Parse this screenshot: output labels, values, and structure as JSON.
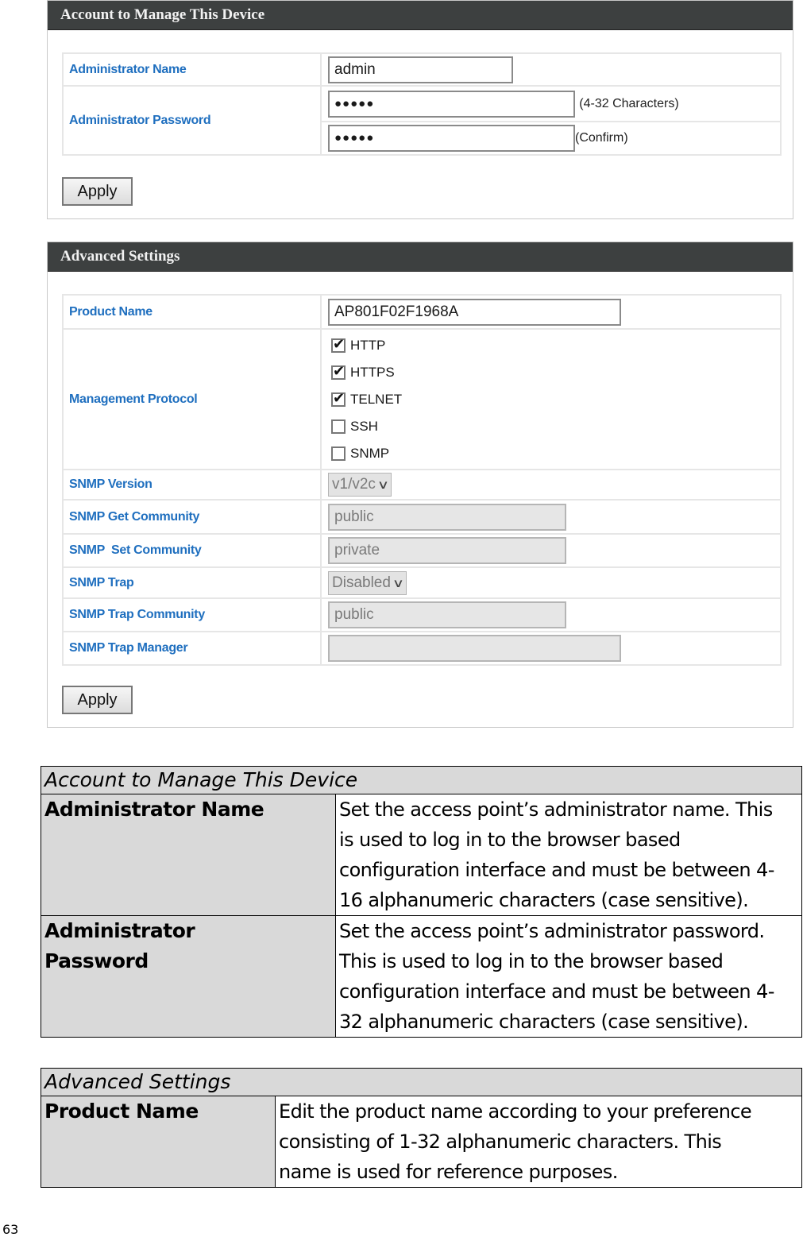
{
  "account_panel": {
    "title": "Account to Manage This Device",
    "admin_name_label": "Administrator Name",
    "admin_name_value": "admin",
    "admin_password_label": "Administrator Password",
    "password_value": "●●●●●",
    "confirm_value": "●●●●●",
    "password_hint": "(4-32 Characters)",
    "confirm_hint": "(Confirm)",
    "apply_label": "Apply"
  },
  "advanced_panel": {
    "title": "Advanced Settings",
    "product_name_label": "Product Name",
    "product_name_value": "AP801F02F1968A",
    "management_protocol_label": "Management Protocol",
    "protocols": [
      {
        "label": "HTTP",
        "checked": true
      },
      {
        "label": "HTTPS",
        "checked": true
      },
      {
        "label": "TELNET",
        "checked": true
      },
      {
        "label": "SSH",
        "checked": false
      },
      {
        "label": "SNMP",
        "checked": false
      }
    ],
    "snmp_version_label": "SNMP Version",
    "snmp_version_value": "v1/v2c",
    "snmp_get_label": "SNMP Get Community",
    "snmp_get_value": "public",
    "snmp_set_label": "SNMP  Set Community",
    "snmp_set_value": "private",
    "snmp_trap_label": "SNMP Trap",
    "snmp_trap_value": "Disabled",
    "snmp_trap_community_label": "SNMP Trap Community",
    "snmp_trap_community_value": "public",
    "snmp_trap_manager_label": "SNMP Trap Manager",
    "snmp_trap_manager_value": "",
    "apply_label": "Apply"
  },
  "doc_account": {
    "heading": "Account to Manage This Device",
    "rows": [
      {
        "term": "Administrator Name",
        "desc": "Set the access point’s administrator name. This is used to log in to the browser based configuration interface and must be between 4-16 alphanumeric characters (case sensitive)."
      },
      {
        "term": "Administrator Password",
        "desc": "Set the access point’s administrator password. This is used to log in to the browser based configuration interface and must be between 4-32 alphanumeric characters (case sensitive)."
      }
    ]
  },
  "doc_advanced": {
    "heading": "Advanced Settings",
    "rows": [
      {
        "term": "Product Name",
        "desc": "Edit the product name according to your preference consisting of 1-32 alphanumeric characters. This name is used for reference purposes."
      }
    ]
  },
  "page_number": "63"
}
